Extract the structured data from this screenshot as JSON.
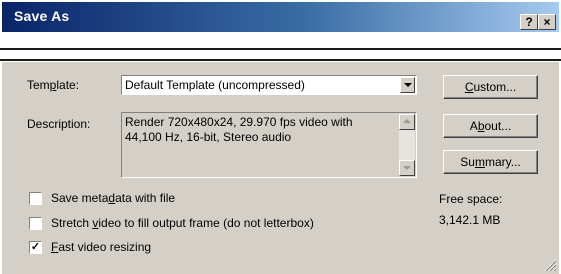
{
  "window": {
    "title": "Save As",
    "help_button": "?",
    "close_button": "×"
  },
  "template": {
    "label_before": "Tem",
    "label_mnemonic": "p",
    "label_after": "late:",
    "value": "Default Template (uncompressed)"
  },
  "description": {
    "label": "Description:",
    "text": "Render 720x480x24, 29.970 fps video with\n44,100 Hz, 16-bit, Stereo audio"
  },
  "buttons": {
    "custom": {
      "mnemonic": "C",
      "rest": "ustom..."
    },
    "about": {
      "before": "A",
      "mnemonic": "b",
      "after": "out..."
    },
    "summary": {
      "before": "Su",
      "mnemonic": "m",
      "after": "mary..."
    }
  },
  "options": [
    {
      "before": "Save meta",
      "mnemonic": "d",
      "after": "ata with file",
      "checked": false
    },
    {
      "before": "Stretch ",
      "mnemonic": "v",
      "after": "ideo to fill output frame (do not letterbox)",
      "checked": false
    },
    {
      "before": "",
      "mnemonic": "F",
      "after": "ast video resizing",
      "checked": true
    }
  ],
  "check_mark": "✓",
  "free_space": {
    "label": "Free space:",
    "value": "3,142.1 MB"
  },
  "colors": {
    "title_bar_start": "#0a246a",
    "title_bar_end": "#a6caf0",
    "dialog_face": "#d4d0c8"
  }
}
